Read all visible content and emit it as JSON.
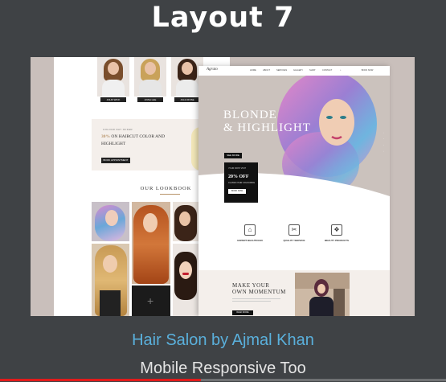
{
  "title": "Layout 7",
  "caption": {
    "line1": "Hair Salon by Ajmal Khan",
    "line2": "Mobile Responsive Too"
  },
  "video": {
    "progress": 0.45,
    "progress_color": "#e21b1b"
  },
  "left_page": {
    "team_buttons": [
      "JOHN WICK",
      "ANNA LEE",
      "JULIA ROSE"
    ],
    "promo": {
      "small": "COLOUR DAY OFFER",
      "highlight": "30%",
      "title_rest": "ON HAIRCUT COLOR AND HIGHLIGHT",
      "button": "BOOK APPOINTMENT"
    },
    "lookbook_title": "OUR LOOKBOOK"
  },
  "right_page": {
    "logo": "Agrato",
    "nav": [
      "HOME",
      "ABOUT",
      "SERVICES",
      "GALLERY",
      "SHOP",
      "CONTACT"
    ],
    "nav_cta": "BOOK NOW",
    "hero": {
      "title_line1": "BLONDE",
      "title_line2": "& HIGHLIGHT",
      "button": "SEE MORE"
    },
    "offer": {
      "small": "YOUR FIRST VISIT",
      "big": "20% OFF",
      "text": "CLASSIC HAIR COLOURING",
      "button": "BOOK NOW"
    },
    "features": [
      {
        "icon": "chair-icon",
        "glyph": "⌂",
        "title": "EXPERT BEAUTICIAN"
      },
      {
        "icon": "dryer-icon",
        "glyph": "✂",
        "title": "QUALITY SERVICE"
      },
      {
        "icon": "cream-icon",
        "glyph": "❖",
        "title": "BEAUTY PRODUCTS"
      }
    ],
    "momentum": {
      "title_line1": "MAKE YOUR",
      "title_line2": "OWN MOMENTUM",
      "button": "READ MORE"
    }
  },
  "colors": {
    "background": "#3f4245",
    "caption_blue": "#5ab0dc",
    "accent_gold": "#b8946a"
  }
}
